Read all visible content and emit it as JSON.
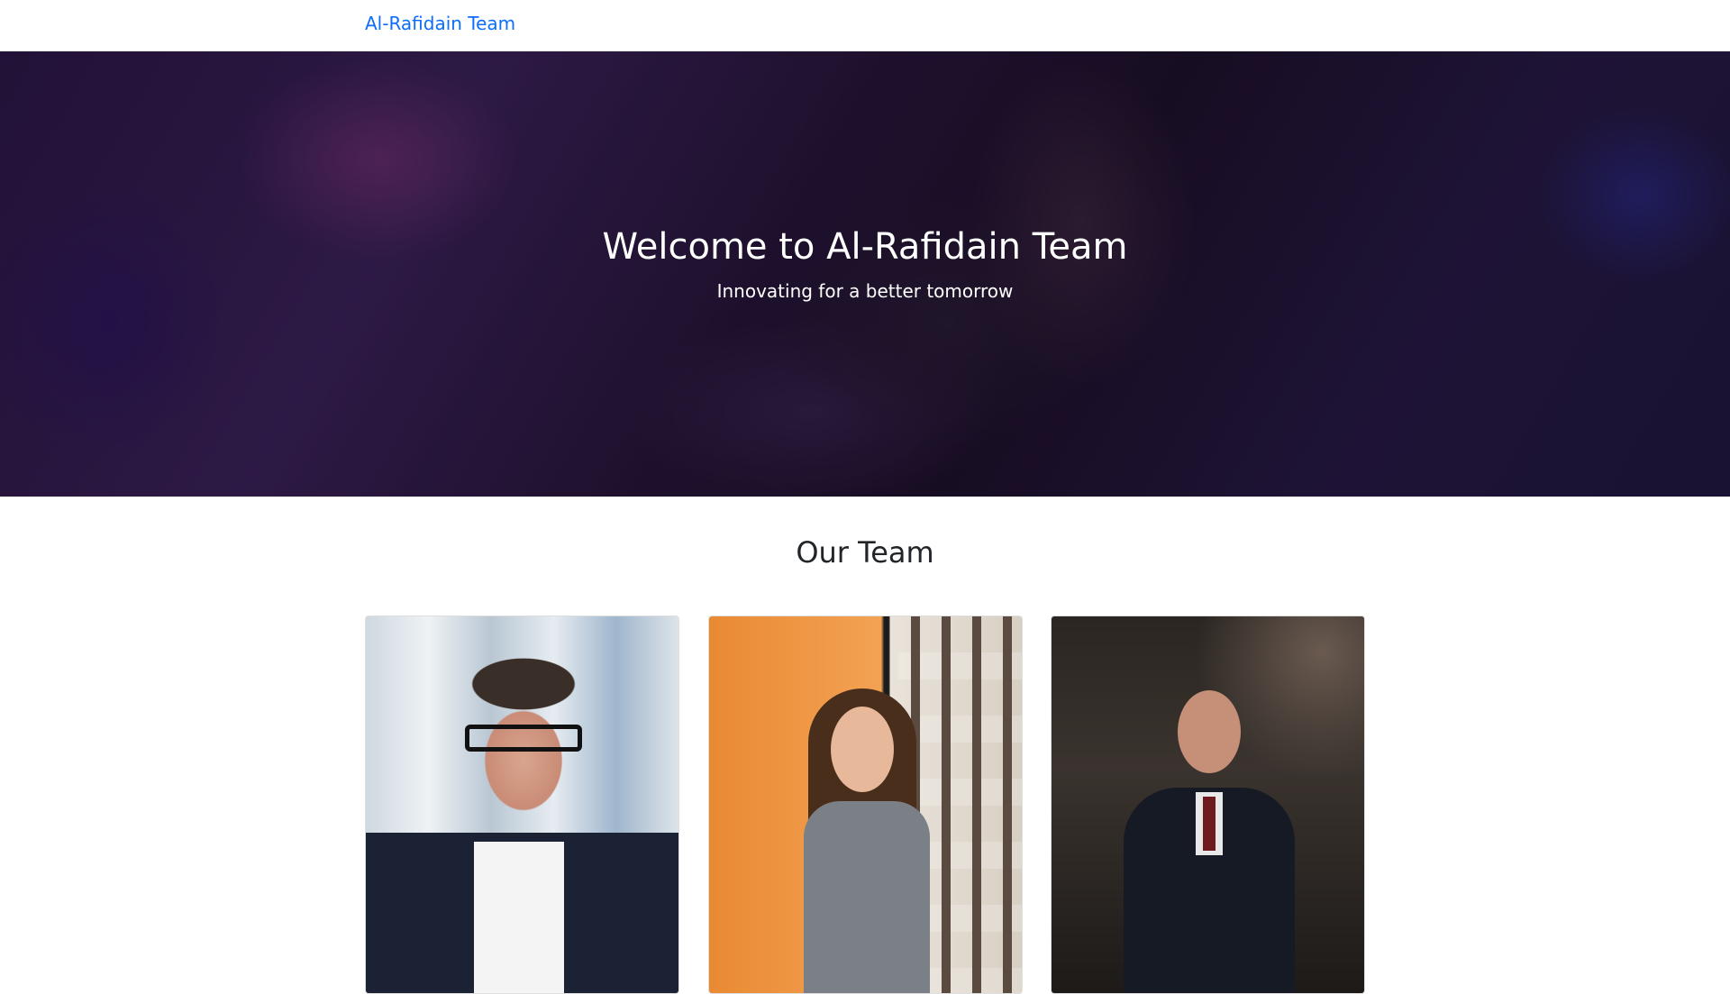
{
  "navbar": {
    "brand": "Al-Rafidain Team"
  },
  "hero": {
    "title": "Welcome to Al-Rafidain Team",
    "subtitle": "Innovating for a better tomorrow"
  },
  "team_section": {
    "title": "Our Team",
    "members": [
      {
        "photo": "team-member-1-photo"
      },
      {
        "photo": "team-member-2-photo"
      },
      {
        "photo": "team-member-3-photo"
      }
    ]
  },
  "colors": {
    "brand_link": "#0d6efd",
    "text": "#212529",
    "hero_text": "#ffffff"
  }
}
